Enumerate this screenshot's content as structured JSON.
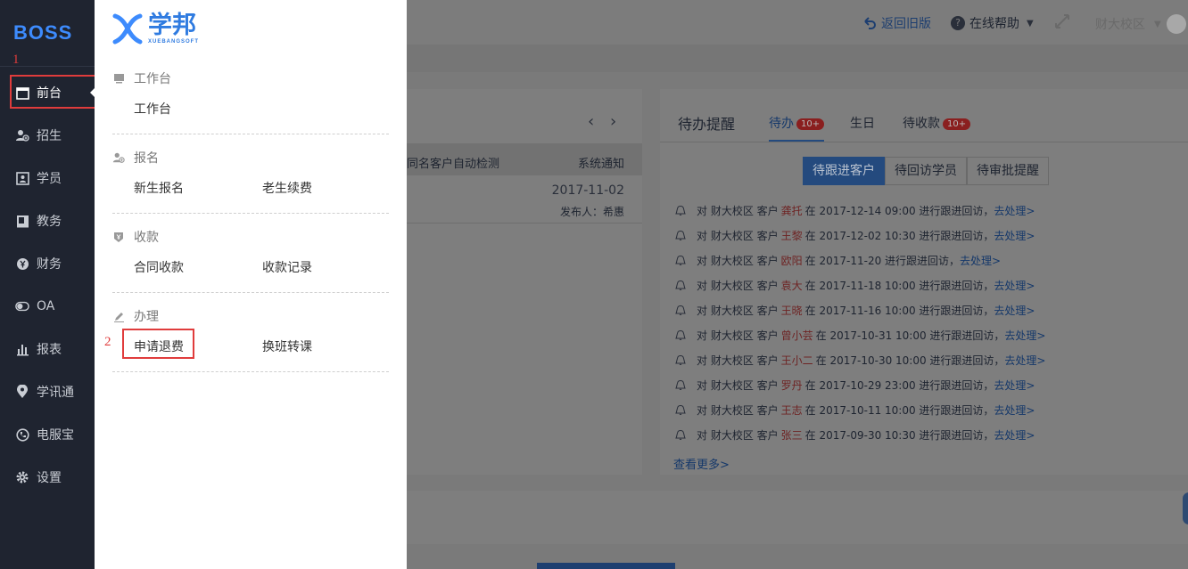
{
  "sidebar": {
    "brand": "BOSS",
    "annotation_1": "1",
    "items": [
      {
        "label": "前台",
        "icon": "calendar-icon"
      },
      {
        "label": "招生",
        "icon": "user-add-icon"
      },
      {
        "label": "学员",
        "icon": "id-card-icon"
      },
      {
        "label": "教务",
        "icon": "book-icon"
      },
      {
        "label": "财务",
        "icon": "yen-icon"
      },
      {
        "label": "OA",
        "icon": "toggle-icon"
      },
      {
        "label": "报表",
        "icon": "bar-chart-icon"
      },
      {
        "label": "学讯通",
        "icon": "location-icon"
      },
      {
        "label": "电服宝",
        "icon": "phone-icon"
      },
      {
        "label": "设置",
        "icon": "gear-icon"
      }
    ]
  },
  "flyout": {
    "logo_cn": "学邦",
    "logo_en": "XUEBANGSOFT",
    "annotation_2": "2",
    "groups": [
      {
        "title": "工作台",
        "links": [
          "工作台"
        ]
      },
      {
        "title": "报名",
        "links": [
          "新生报名",
          "老生续费"
        ]
      },
      {
        "title": "收款",
        "links": [
          "合同收款",
          "收款记录"
        ]
      },
      {
        "title": "办理",
        "links": [
          "申请退费",
          "换班转课"
        ]
      }
    ]
  },
  "topbar": {
    "back": "返回旧版",
    "help": "在线帮助",
    "campus": "财大校区"
  },
  "notice": {
    "text": "同名客户自动检测",
    "type": "系统通知",
    "date": "2017-11-02",
    "publisher": "发布人：希惠"
  },
  "todo": {
    "title": "待办提醒",
    "tabs": [
      {
        "label": "待办",
        "badge": "10+"
      },
      {
        "label": "生日",
        "badge": ""
      },
      {
        "label": "待收款",
        "badge": "10+"
      }
    ],
    "segments": [
      "待跟进客户",
      "待回访学员",
      "待审批提醒"
    ],
    "rows": [
      {
        "pre": "对 财大校区 客户",
        "name": "龚托",
        "post": "在 2017-12-14 09:00 进行跟进回访，",
        "link": "去处理>"
      },
      {
        "pre": "对 财大校区 客户",
        "name": "王黎",
        "post": "在 2017-12-02 10:30 进行跟进回访，",
        "link": "去处理>"
      },
      {
        "pre": "对 财大校区 客户",
        "name": "欧阳",
        "post": "在 2017-11-20 进行跟进回访，",
        "link": "去处理>"
      },
      {
        "pre": "对 财大校区 客户",
        "name": "袁大",
        "post": "在 2017-11-18 10:00 进行跟进回访，",
        "link": "去处理>"
      },
      {
        "pre": "对 财大校区 客户",
        "name": "王晓",
        "post": "在 2017-11-16 10:00 进行跟进回访，",
        "link": "去处理>"
      },
      {
        "pre": "对 财大校区 客户",
        "name": "曾小芸",
        "post": "在 2017-10-31 10:00 进行跟进回访，",
        "link": "去处理>"
      },
      {
        "pre": "对 财大校区 客户",
        "name": "王小二",
        "post": "在 2017-10-30 10:00 进行跟进回访，",
        "link": "去处理>"
      },
      {
        "pre": "对 财大校区 客户",
        "name": "罗丹",
        "post": "在 2017-10-29 23:00 进行跟进回访，",
        "link": "去处理>"
      },
      {
        "pre": "对 财大校区 客户",
        "name": "王志",
        "post": "在 2017-10-11 10:00 进行跟进回访，",
        "link": "去处理>"
      },
      {
        "pre": "对 财大校区 客户",
        "name": "张三",
        "post": "在 2017-09-30 10:30 进行跟进回访，",
        "link": "去处理>"
      }
    ],
    "more": "查看更多>"
  },
  "colors": {
    "sidebar_bg": "#1f2430",
    "accent_blue": "#3d8bfd",
    "annotation_red": "#e03c3c"
  }
}
